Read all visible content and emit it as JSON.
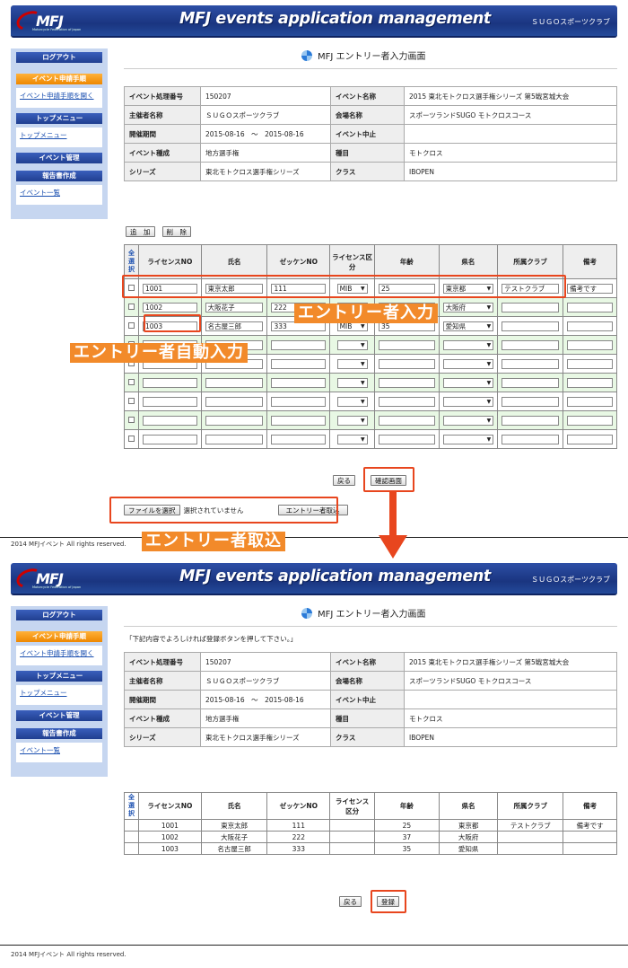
{
  "header": {
    "logo": "MFJ",
    "logo_sub": "Motorcycle Federation of Japan",
    "title": "MFJ events application management",
    "org": "ＳＵＧＯスポーツクラブ"
  },
  "sidebar": {
    "logout": "ログアウト",
    "event_procedure": "イベント申請手順",
    "event_procedure_link": "イベント申請手順を開く",
    "top_menu": "トップメニュー",
    "top_menu_link": "トップメニュー",
    "event_admin": "イベント管理",
    "report": "報告書作成",
    "event_list": "イベント一覧"
  },
  "page_title": "MFJ エントリー者入力画面",
  "confirm_message": "「下記内容でよろしければ登録ボタンを押して下さい。」",
  "info": {
    "rows": [
      {
        "l1": "イベント処理番号",
        "v1": "150207",
        "l2": "イベント名称",
        "v2": "2015 東北モトクロス選手権シリーズ 第5戦宮城大会"
      },
      {
        "l1": "主催者名称",
        "v1": "ＳＵＧＯスポーツクラブ",
        "l2": "会場名称",
        "v2": "スポーツランドSUGO モトクロスコース"
      },
      {
        "l1": "開催期間",
        "v1": "2015-08-16　～　2015-08-16",
        "l2": "イベント中止",
        "v2": ""
      },
      {
        "l1": "イベント種成",
        "v1": "地方選手権",
        "l2": "種目",
        "v2": "モトクロス"
      },
      {
        "l1": "シリーズ",
        "v1": "東北モトクロス選手権シリーズ",
        "l2": "クラス",
        "v2": "IBOPEN"
      }
    ]
  },
  "buttons": {
    "add": "追　加",
    "delete": "削　除",
    "back": "戻る",
    "confirm": "確認画面",
    "file_select": "ファイルを選択",
    "no_file": "選択されていません",
    "import": "エントリー者取込",
    "register": "登録"
  },
  "entry_table": {
    "select_all": "全選択",
    "headers": [
      "ライセンスNO",
      "氏名",
      "ゼッケンNO",
      "ライセンス区分",
      "年齢",
      "県名",
      "所属クラブ",
      "備考"
    ],
    "rows": [
      {
        "license": "1001",
        "name": "東京太郎",
        "number": "111",
        "kubun": "MIB",
        "age": "25",
        "pref": "東京都",
        "club": "テストクラブ",
        "note": "備考です"
      },
      {
        "license": "1002",
        "name": "大阪花子",
        "number": "222",
        "kubun": "",
        "age": "37",
        "pref": "大阪府",
        "club": "",
        "note": ""
      },
      {
        "license": "1003",
        "name": "名古屋三郎",
        "number": "333",
        "kubun": "MIB",
        "age": "35",
        "pref": "愛知県",
        "club": "",
        "note": ""
      }
    ]
  },
  "annotations": {
    "entry_input": "エントリー者入力",
    "auto_input": "エントリー者自動入力",
    "import": "エントリー者取込"
  },
  "result_table": {
    "select_all": "全選択",
    "headers": [
      "ライセンスNO",
      "氏名",
      "ゼッケンNO",
      "ライセンス区分",
      "年齢",
      "県名",
      "所属クラブ",
      "備考"
    ],
    "rows": [
      {
        "license": "1001",
        "name": "東京太郎",
        "number": "111",
        "kubun": "",
        "age": "25",
        "pref": "東京都",
        "club": "テストクラブ",
        "note": "備考です"
      },
      {
        "license": "1002",
        "name": "大阪花子",
        "number": "222",
        "kubun": "",
        "age": "37",
        "pref": "大阪府",
        "club": "",
        "note": ""
      },
      {
        "license": "1003",
        "name": "名古屋三郎",
        "number": "333",
        "kubun": "",
        "age": "35",
        "pref": "愛知県",
        "club": "",
        "note": ""
      }
    ]
  },
  "footer": "2014 MFJイベント All rights reserved.",
  "colors": {
    "header": "#1a3580",
    "accent": "#e8461e",
    "callout": "#f28a2a",
    "alt_row": "#e8f8e4"
  }
}
